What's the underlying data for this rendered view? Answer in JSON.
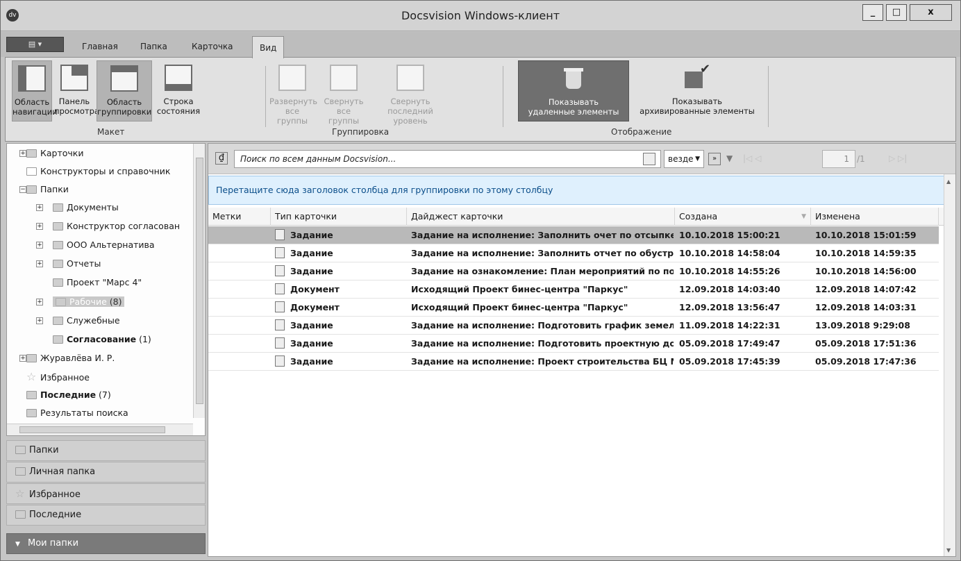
{
  "window": {
    "title": "Docsvision Windows-клиент",
    "logo": "dv",
    "controls": {
      "minimize": "_",
      "maximize": "□",
      "close": "x"
    }
  },
  "menu": {
    "app_button_icon": "menu-icon",
    "tabs": [
      "Главная",
      "Папка",
      "Карточка",
      "Вид"
    ],
    "active_tab": "Вид"
  },
  "ribbon": {
    "groups": [
      {
        "label": "Макет",
        "buttons": [
          {
            "line1": "Область",
            "line2": "навигации",
            "state": "on"
          },
          {
            "line1": "Панель",
            "line2": "просмотра",
            "state": "normal"
          },
          {
            "line1": "Область",
            "line2": "группировки",
            "state": "on"
          },
          {
            "line1": "Строка",
            "line2": "состояния",
            "state": "normal"
          }
        ]
      },
      {
        "label": "Группировка",
        "buttons": [
          {
            "line1": "Развернуть",
            "line2": "все группы",
            "state": "disabled"
          },
          {
            "line1": "Свернуть все",
            "line2": "группы",
            "state": "disabled"
          },
          {
            "line1": "Свернуть",
            "line2": "последний уровень",
            "state": "disabled"
          }
        ]
      },
      {
        "label": "Отображение",
        "buttons": [
          {
            "line1": "Показывать",
            "line2": "удаленные элементы",
            "state": "pressed"
          },
          {
            "line1": "Показывать",
            "line2": "архивированные элементы",
            "state": "normal"
          }
        ]
      }
    ]
  },
  "tree": {
    "items": [
      {
        "label": "Карточки",
        "expander": "+",
        "count": ""
      },
      {
        "label": "Конструкторы и справочник",
        "expander": "",
        "count": ""
      },
      {
        "label": "Папки",
        "expander": "−",
        "count": ""
      },
      {
        "label": "Документы",
        "expander": "+",
        "count": ""
      },
      {
        "label": "Конструктор согласован",
        "expander": "+",
        "count": ""
      },
      {
        "label": "ООО Альтернатива",
        "expander": "+",
        "count": ""
      },
      {
        "label": "Отчеты",
        "expander": "+",
        "count": ""
      },
      {
        "label": "Проект \"Марс 4\"",
        "expander": "",
        "count": ""
      },
      {
        "label": "Рабочие",
        "expander": "+",
        "count": "(8)"
      },
      {
        "label": "Служебные",
        "expander": "+",
        "count": ""
      },
      {
        "label": "Согласование",
        "expander": "",
        "count": "(1)"
      },
      {
        "label": "Журавлёва И. Р.",
        "expander": "+",
        "count": ""
      },
      {
        "label": "Избранное",
        "expander": "",
        "count": ""
      },
      {
        "label": "Последние",
        "expander": "",
        "count": "(7)"
      },
      {
        "label": "Результаты поиска",
        "expander": "",
        "count": ""
      }
    ]
  },
  "nav_buttons": [
    "Папки",
    "Личная папка",
    "Избранное",
    "Последние",
    "Мои папки"
  ],
  "search": {
    "placeholder": "Поиск по всем данным Docsvision...",
    "scope": "везде",
    "page_current": "1",
    "page_total": "/1"
  },
  "group_zone": {
    "text": "Перетащите сюда заголовок столбца для группировки по этому столбцу"
  },
  "table": {
    "columns": [
      "Метки",
      "Тип карточки",
      "Дайджест карточки",
      "Создана",
      "Изменена"
    ],
    "rows": [
      [
        "",
        "Задание",
        "Задание на исполнение: Заполнить очет по отсыпке...",
        "10.10.2018 15:00:21",
        "10.10.2018 15:01:59"
      ],
      [
        "",
        "Задание",
        "Задание на исполнение: Заполнить отчет по обустро...",
        "10.10.2018 14:58:04",
        "10.10.2018 14:59:35"
      ],
      [
        "",
        "Задание",
        "Задание на ознакомление: План мероприятий по по...",
        "10.10.2018 14:55:26",
        "10.10.2018 14:56:00"
      ],
      [
        "",
        "Документ",
        "Исходящий Проект бинес-центра \"Паркус\"",
        "12.09.2018 14:03:40",
        "12.09.2018 14:07:42"
      ],
      [
        "",
        "Документ",
        "Исходящий Проект бинес-центра \"Паркус\"",
        "12.09.2018 13:56:47",
        "12.09.2018 14:03:31"
      ],
      [
        "",
        "Задание",
        "Задание на исполнение: Подготовить график земел...",
        "11.09.2018 14:22:31",
        "13.09.2018 9:29:08"
      ],
      [
        "",
        "Задание",
        "Задание на исполнение: Подготовить проектную до...",
        "05.09.2018 17:49:47",
        "05.09.2018 17:51:36"
      ],
      [
        "",
        "Задание",
        "Задание на исполнение: Проект строительства БЦ М...",
        "05.09.2018 17:45:39",
        "05.09.2018 17:47:36"
      ]
    ]
  }
}
